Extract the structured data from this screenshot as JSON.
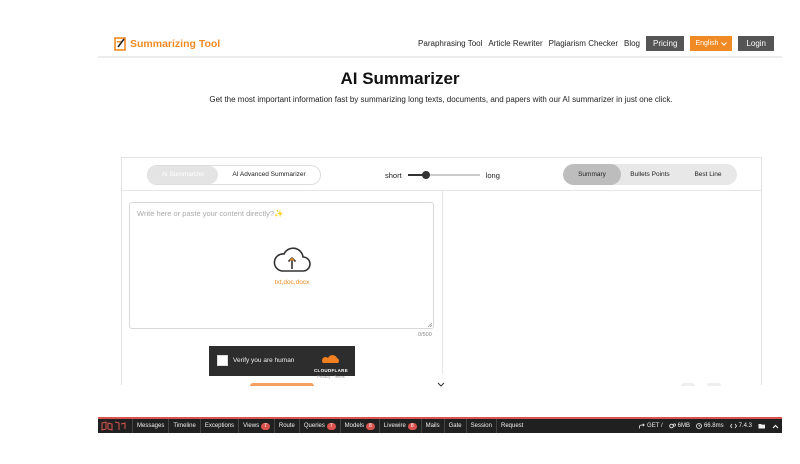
{
  "header": {
    "logo_text": "Summarizing Tool",
    "nav": [
      "Paraphrasing Tool",
      "Article Rewriter",
      "Plagiarism Checker",
      "Blog"
    ],
    "pricing_label": "Pricing",
    "language_label": "English",
    "login_label": "Login"
  },
  "hero": {
    "title": "AI Summarizer",
    "subtitle": "Get the most important information fast by summarizing long texts, documents, and papers with our AI summarizer in just one click."
  },
  "tool": {
    "modes": [
      "AI Summarizer",
      "AI Advanced Summarizer"
    ],
    "length_short": "short",
    "length_long": "long",
    "length_level": 0.25,
    "output_tabs": [
      "Summary",
      "Bullets Points",
      "Best Line"
    ],
    "active_output": "Summary",
    "input_placeholder": "Write here or paste your content directly?✨",
    "upload_types": "txt,doc,docx",
    "char_count": "0/500"
  },
  "captcha": {
    "label": "Verify you are human",
    "provider": "CLOUDFLARE",
    "links": "Privacy · Terms"
  },
  "debugbar": {
    "tabs": [
      {
        "label": "Messages",
        "badge": ""
      },
      {
        "label": "Timeline",
        "badge": ""
      },
      {
        "label": "Exceptions",
        "badge": ""
      },
      {
        "label": "Views",
        "badge": "7"
      },
      {
        "label": "Route",
        "badge": ""
      },
      {
        "label": "Queries",
        "badge": "7"
      },
      {
        "label": "Models",
        "badge": "8"
      },
      {
        "label": "Livewire",
        "badge": "8"
      },
      {
        "label": "Mails",
        "badge": ""
      },
      {
        "label": "Gate",
        "badge": ""
      },
      {
        "label": "Session",
        "badge": ""
      },
      {
        "label": "Request",
        "badge": ""
      }
    ],
    "method": "GET /",
    "memory": "6MB",
    "duration": "66.8ms",
    "php_version": "7.4.3"
  },
  "colors": {
    "brand_orange": "#f08a24",
    "dark_button": "#555555",
    "debugbar_bg": "#202020",
    "debugbar_accent": "#d9534f"
  }
}
